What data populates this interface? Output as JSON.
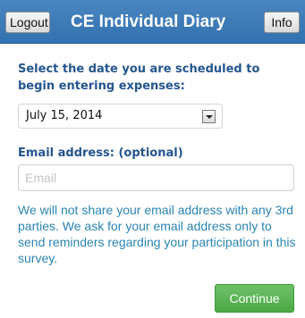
{
  "header": {
    "logout_label": "Logout",
    "title": "CE Individual Diary",
    "info_label": "Info"
  },
  "form": {
    "date_label": "Select the date you are scheduled to begin entering expenses:",
    "date_selected": "July 15, 2014",
    "email_label": "Email address: (optional)",
    "email_placeholder": "Email",
    "email_value": "",
    "privacy_note": "We will not share your email address with any 3rd parties. We ask for your email address only to send reminders regarding your participation in this survey.",
    "continue_label": "Continue"
  },
  "colors": {
    "header_bg": "#3b78b5",
    "label_text": "#24558f",
    "note_text": "#2b85b5",
    "continue_bg": "#5cb85c"
  }
}
